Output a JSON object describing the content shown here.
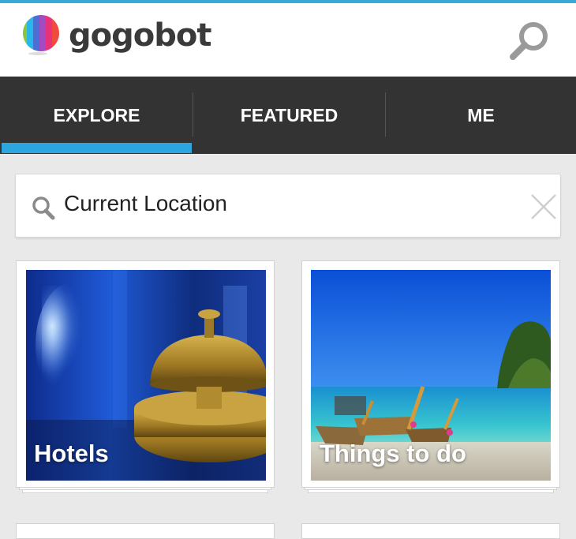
{
  "app": {
    "name": "gogobot"
  },
  "colors": {
    "accent": "#2ca6df",
    "tab_bar": "#333333",
    "background": "#e9e9e9"
  },
  "header": {
    "logo_text": "gogobot",
    "search_icon": "search-icon"
  },
  "tabs": [
    {
      "label": "EXPLORE",
      "selected": true
    },
    {
      "label": "FEATURED",
      "selected": false
    },
    {
      "label": "ME",
      "selected": false
    }
  ],
  "search": {
    "value": "Current Location",
    "clear_icon": "close-icon"
  },
  "cards": [
    {
      "label": "Hotels",
      "image": "hotel-bell-image"
    },
    {
      "label": "Things to do",
      "image": "beach-boats-image"
    }
  ]
}
